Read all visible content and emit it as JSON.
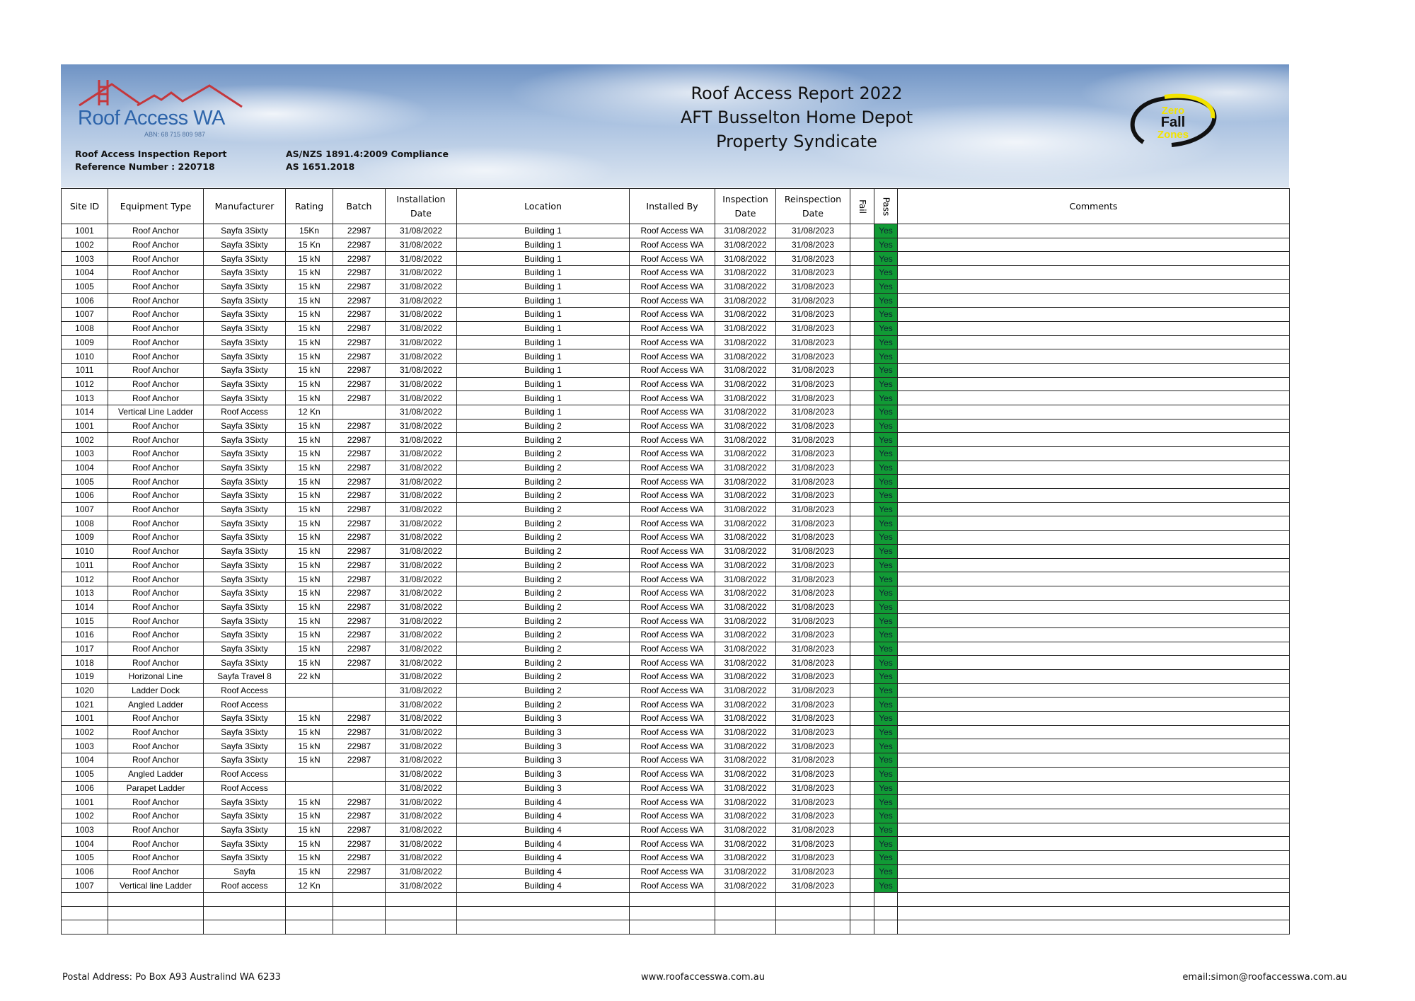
{
  "header": {
    "company_name": "Roof Access WA",
    "abn": "ABN: 68 715 809 987",
    "report_label": "Roof Access Inspection Report",
    "reference": "Reference Number : 220718",
    "compliance_1": "AS/NZS 1891.4:2009 Compliance",
    "compliance_2": "AS 1651.2018",
    "title_1": "Roof Access Report 2022",
    "title_2": "AFT Busselton Home Depot",
    "title_3": "Property Syndicate",
    "badge_lines": [
      "Zero",
      "Fall",
      "Zones"
    ]
  },
  "table": {
    "columns": [
      "Site ID",
      "Equipment Type",
      "Manufacturer",
      "Rating",
      "Batch",
      "Installation Date",
      "Location",
      "Installed By",
      "Inspection Date",
      "Reinspection Date",
      "Fail",
      "Pass",
      "Comments"
    ],
    "rows": [
      [
        "1001",
        "Roof Anchor",
        "Sayfa 3Sixty",
        "15Kn",
        "22987",
        "31/08/2022",
        "Building 1",
        "Roof Access WA",
        "31/08/2022",
        "31/08/2023",
        "",
        "Yes",
        ""
      ],
      [
        "1002",
        "Roof Anchor",
        "Sayfa 3Sixty",
        "15 Kn",
        "22987",
        "31/08/2022",
        "Building 1",
        "Roof Access WA",
        "31/08/2022",
        "31/08/2023",
        "",
        "Yes",
        ""
      ],
      [
        "1003",
        "Roof Anchor",
        "Sayfa 3Sixty",
        "15 kN",
        "22987",
        "31/08/2022",
        "Building 1",
        "Roof Access WA",
        "31/08/2022",
        "31/08/2023",
        "",
        "Yes",
        ""
      ],
      [
        "1004",
        "Roof Anchor",
        "Sayfa 3Sixty",
        "15 kN",
        "22987",
        "31/08/2022",
        "Building 1",
        "Roof Access WA",
        "31/08/2022",
        "31/08/2023",
        "",
        "Yes",
        ""
      ],
      [
        "1005",
        "Roof Anchor",
        "Sayfa 3Sixty",
        "15 kN",
        "22987",
        "31/08/2022",
        "Building 1",
        "Roof Access WA",
        "31/08/2022",
        "31/08/2023",
        "",
        "Yes",
        ""
      ],
      [
        "1006",
        "Roof Anchor",
        "Sayfa 3Sixty",
        "15 kN",
        "22987",
        "31/08/2022",
        "Building 1",
        "Roof Access WA",
        "31/08/2022",
        "31/08/2023",
        "",
        "Yes",
        ""
      ],
      [
        "1007",
        "Roof Anchor",
        "Sayfa 3Sixty",
        "15 kN",
        "22987",
        "31/08/2022",
        "Building 1",
        "Roof Access WA",
        "31/08/2022",
        "31/08/2023",
        "",
        "Yes",
        ""
      ],
      [
        "1008",
        "Roof Anchor",
        "Sayfa 3Sixty",
        "15 kN",
        "22987",
        "31/08/2022",
        "Building 1",
        "Roof Access WA",
        "31/08/2022",
        "31/08/2023",
        "",
        "Yes",
        ""
      ],
      [
        "1009",
        "Roof Anchor",
        "Sayfa 3Sixty",
        "15 kN",
        "22987",
        "31/08/2022",
        "Building 1",
        "Roof Access WA",
        "31/08/2022",
        "31/08/2023",
        "",
        "Yes",
        ""
      ],
      [
        "1010",
        "Roof Anchor",
        "Sayfa 3Sixty",
        "15 kN",
        "22987",
        "31/08/2022",
        "Building 1",
        "Roof Access WA",
        "31/08/2022",
        "31/08/2023",
        "",
        "Yes",
        ""
      ],
      [
        "1011",
        "Roof Anchor",
        "Sayfa 3Sixty",
        "15 kN",
        "22987",
        "31/08/2022",
        "Building 1",
        "Roof Access WA",
        "31/08/2022",
        "31/08/2023",
        "",
        "Yes",
        ""
      ],
      [
        "1012",
        "Roof Anchor",
        "Sayfa 3Sixty",
        "15 kN",
        "22987",
        "31/08/2022",
        "Building 1",
        "Roof Access WA",
        "31/08/2022",
        "31/08/2023",
        "",
        "Yes",
        ""
      ],
      [
        "1013",
        "Roof Anchor",
        "Sayfa 3Sixty",
        "15 kN",
        "22987",
        "31/08/2022",
        "Building 1",
        "Roof Access WA",
        "31/08/2022",
        "31/08/2023",
        "",
        "Yes",
        ""
      ],
      [
        "1014",
        "Vertical Line Ladder",
        "Roof Access",
        "12 Kn",
        "",
        "31/08/2022",
        "Building 1",
        "Roof Access WA",
        "31/08/2022",
        "31/08/2023",
        "",
        "Yes",
        ""
      ],
      [
        "1001",
        "Roof Anchor",
        "Sayfa 3Sixty",
        "15 kN",
        "22987",
        "31/08/2022",
        "Building 2",
        "Roof Access WA",
        "31/08/2022",
        "31/08/2023",
        "",
        "Yes",
        ""
      ],
      [
        "1002",
        "Roof Anchor",
        "Sayfa 3Sixty",
        "15 kN",
        "22987",
        "31/08/2022",
        "Building 2",
        "Roof Access WA",
        "31/08/2022",
        "31/08/2023",
        "",
        "Yes",
        ""
      ],
      [
        "1003",
        "Roof Anchor",
        "Sayfa 3Sixty",
        "15 kN",
        "22987",
        "31/08/2022",
        "Building 2",
        "Roof Access WA",
        "31/08/2022",
        "31/08/2023",
        "",
        "Yes",
        ""
      ],
      [
        "1004",
        "Roof Anchor",
        "Sayfa 3Sixty",
        "15 kN",
        "22987",
        "31/08/2022",
        "Building 2",
        "Roof Access WA",
        "31/08/2022",
        "31/08/2023",
        "",
        "Yes",
        ""
      ],
      [
        "1005",
        "Roof Anchor",
        "Sayfa 3Sixty",
        "15 kN",
        "22987",
        "31/08/2022",
        "Building 2",
        "Roof Access WA",
        "31/08/2022",
        "31/08/2023",
        "",
        "Yes",
        ""
      ],
      [
        "1006",
        "Roof Anchor",
        "Sayfa 3Sixty",
        "15 kN",
        "22987",
        "31/08/2022",
        "Building 2",
        "Roof Access WA",
        "31/08/2022",
        "31/08/2023",
        "",
        "Yes",
        ""
      ],
      [
        "1007",
        "Roof Anchor",
        "Sayfa 3Sixty",
        "15 kN",
        "22987",
        "31/08/2022",
        "Building 2",
        "Roof Access WA",
        "31/08/2022",
        "31/08/2023",
        "",
        "Yes",
        ""
      ],
      [
        "1008",
        "Roof Anchor",
        "Sayfa 3Sixty",
        "15 kN",
        "22987",
        "31/08/2022",
        "Building 2",
        "Roof Access WA",
        "31/08/2022",
        "31/08/2023",
        "",
        "Yes",
        ""
      ],
      [
        "1009",
        "Roof Anchor",
        "Sayfa 3Sixty",
        "15 kN",
        "22987",
        "31/08/2022",
        "Building 2",
        "Roof Access WA",
        "31/08/2022",
        "31/08/2023",
        "",
        "Yes",
        ""
      ],
      [
        "1010",
        "Roof Anchor",
        "Sayfa 3Sixty",
        "15 kN",
        "22987",
        "31/08/2022",
        "Building 2",
        "Roof Access WA",
        "31/08/2022",
        "31/08/2023",
        "",
        "Yes",
        ""
      ],
      [
        "1011",
        "Roof Anchor",
        "Sayfa 3Sixty",
        "15 kN",
        "22987",
        "31/08/2022",
        "Building 2",
        "Roof Access WA",
        "31/08/2022",
        "31/08/2023",
        "",
        "Yes",
        ""
      ],
      [
        "1012",
        "Roof Anchor",
        "Sayfa 3Sixty",
        "15 kN",
        "22987",
        "31/08/2022",
        "Building 2",
        "Roof Access WA",
        "31/08/2022",
        "31/08/2023",
        "",
        "Yes",
        ""
      ],
      [
        "1013",
        "Roof Anchor",
        "Sayfa 3Sixty",
        "15 kN",
        "22987",
        "31/08/2022",
        "Building 2",
        "Roof Access WA",
        "31/08/2022",
        "31/08/2023",
        "",
        "Yes",
        ""
      ],
      [
        "1014",
        "Roof Anchor",
        "Sayfa 3Sixty",
        "15 kN",
        "22987",
        "31/08/2022",
        "Building 2",
        "Roof Access WA",
        "31/08/2022",
        "31/08/2023",
        "",
        "Yes",
        ""
      ],
      [
        "1015",
        "Roof Anchor",
        "Sayfa 3Sixty",
        "15 kN",
        "22987",
        "31/08/2022",
        "Building 2",
        "Roof Access WA",
        "31/08/2022",
        "31/08/2023",
        "",
        "Yes",
        ""
      ],
      [
        "1016",
        "Roof Anchor",
        "Sayfa 3Sixty",
        "15 kN",
        "22987",
        "31/08/2022",
        "Building 2",
        "Roof Access WA",
        "31/08/2022",
        "31/08/2023",
        "",
        "Yes",
        ""
      ],
      [
        "1017",
        "Roof Anchor",
        "Sayfa 3Sixty",
        "15 kN",
        "22987",
        "31/08/2022",
        "Building 2",
        "Roof Access WA",
        "31/08/2022",
        "31/08/2023",
        "",
        "Yes",
        ""
      ],
      [
        "1018",
        "Roof Anchor",
        "Sayfa 3Sixty",
        "15 kN",
        "22987",
        "31/08/2022",
        "Building 2",
        "Roof Access WA",
        "31/08/2022",
        "31/08/2023",
        "",
        "Yes",
        ""
      ],
      [
        "1019",
        "Horizonal Line",
        "Sayfa Travel 8",
        "22 kN",
        "",
        "31/08/2022",
        "Building 2",
        "Roof Access WA",
        "31/08/2022",
        "31/08/2023",
        "",
        "Yes",
        ""
      ],
      [
        "1020",
        "Ladder Dock",
        "Roof Access",
        "",
        "",
        "31/08/2022",
        "Building 2",
        "Roof Access WA",
        "31/08/2022",
        "31/08/2023",
        "",
        "Yes",
        ""
      ],
      [
        "1021",
        "Angled Ladder",
        "Roof Access",
        "",
        "",
        "31/08/2022",
        "Building 2",
        "Roof Access WA",
        "31/08/2022",
        "31/08/2023",
        "",
        "Yes",
        ""
      ],
      [
        "1001",
        "Roof Anchor",
        "Sayfa 3Sixty",
        "15 kN",
        "22987",
        "31/08/2022",
        "Building 3",
        "Roof Access WA",
        "31/08/2022",
        "31/08/2023",
        "",
        "Yes",
        ""
      ],
      [
        "1002",
        "Roof Anchor",
        "Sayfa 3Sixty",
        "15 kN",
        "22987",
        "31/08/2022",
        "Building 3",
        "Roof Access WA",
        "31/08/2022",
        "31/08/2023",
        "",
        "Yes",
        ""
      ],
      [
        "1003",
        "Roof Anchor",
        "Sayfa 3Sixty",
        "15 kN",
        "22987",
        "31/08/2022",
        "Building 3",
        "Roof Access WA",
        "31/08/2022",
        "31/08/2023",
        "",
        "Yes",
        ""
      ],
      [
        "1004",
        "Roof Anchor",
        "Sayfa 3Sixty",
        "15 kN",
        "22987",
        "31/08/2022",
        "Building 3",
        "Roof Access WA",
        "31/08/2022",
        "31/08/2023",
        "",
        "Yes",
        ""
      ],
      [
        "1005",
        "Angled Ladder",
        "Roof Access",
        "",
        "",
        "31/08/2022",
        "Building 3",
        "Roof Access WA",
        "31/08/2022",
        "31/08/2023",
        "",
        "Yes",
        ""
      ],
      [
        "1006",
        "Parapet Ladder",
        "Roof Access",
        "",
        "",
        "31/08/2022",
        "Building 3",
        "Roof Access WA",
        "31/08/2022",
        "31/08/2023",
        "",
        "Yes",
        ""
      ],
      [
        "1001",
        "Roof Anchor",
        "Sayfa 3Sixty",
        "15 kN",
        "22987",
        "31/08/2022",
        "Building 4",
        "Roof Access WA",
        "31/08/2022",
        "31/08/2023",
        "",
        "Yes",
        ""
      ],
      [
        "1002",
        "Roof Anchor",
        "Sayfa 3Sixty",
        "15 kN",
        "22987",
        "31/08/2022",
        "Building 4",
        "Roof Access WA",
        "31/08/2022",
        "31/08/2023",
        "",
        "Yes",
        ""
      ],
      [
        "1003",
        "Roof Anchor",
        "Sayfa 3Sixty",
        "15 kN",
        "22987",
        "31/08/2022",
        "Building 4",
        "Roof Access WA",
        "31/08/2022",
        "31/08/2023",
        "",
        "Yes",
        ""
      ],
      [
        "1004",
        "Roof Anchor",
        "Sayfa 3Sixty",
        "15 kN",
        "22987",
        "31/08/2022",
        "Building 4",
        "Roof Access WA",
        "31/08/2022",
        "31/08/2023",
        "",
        "Yes",
        ""
      ],
      [
        "1005",
        "Roof Anchor",
        "Sayfa 3Sixty",
        "15 kN",
        "22987",
        "31/08/2022",
        "Building 4",
        "Roof Access WA",
        "31/08/2022",
        "31/08/2023",
        "",
        "Yes",
        ""
      ],
      [
        "1006",
        "Roof Anchor",
        "Sayfa",
        "15 kN",
        "22987",
        "31/08/2022",
        "Building 4",
        "Roof Access WA",
        "31/08/2022",
        "31/08/2023",
        "",
        "Yes",
        ""
      ],
      [
        "1007",
        "Vertical line Ladder",
        "Roof access",
        "12 Kn",
        "",
        "31/08/2022",
        "Building 4",
        "Roof Access WA",
        "31/08/2022",
        "31/08/2023",
        "",
        "Yes",
        ""
      ],
      [
        "",
        "",
        "",
        "",
        "",
        "",
        "",
        "",
        "",
        "",
        "",
        "",
        ""
      ],
      [
        "",
        "",
        "",
        "",
        "",
        "",
        "",
        "",
        "",
        "",
        "",
        "",
        ""
      ],
      [
        "",
        "",
        "",
        "",
        "",
        "",
        "",
        "",
        "",
        "",
        "",
        "",
        ""
      ]
    ]
  },
  "footer": {
    "postal": "Postal Address: Po Box A93 Australind WA 6233",
    "website": "www.roofaccesswa.com.au",
    "email": "email:simon@roofaccesswa.com.au"
  },
  "colors": {
    "pass_fill": "#119a35",
    "brand_blue": "#2d64aa",
    "brand_red": "#c0392b",
    "badge_yellow": "#f2e300"
  }
}
